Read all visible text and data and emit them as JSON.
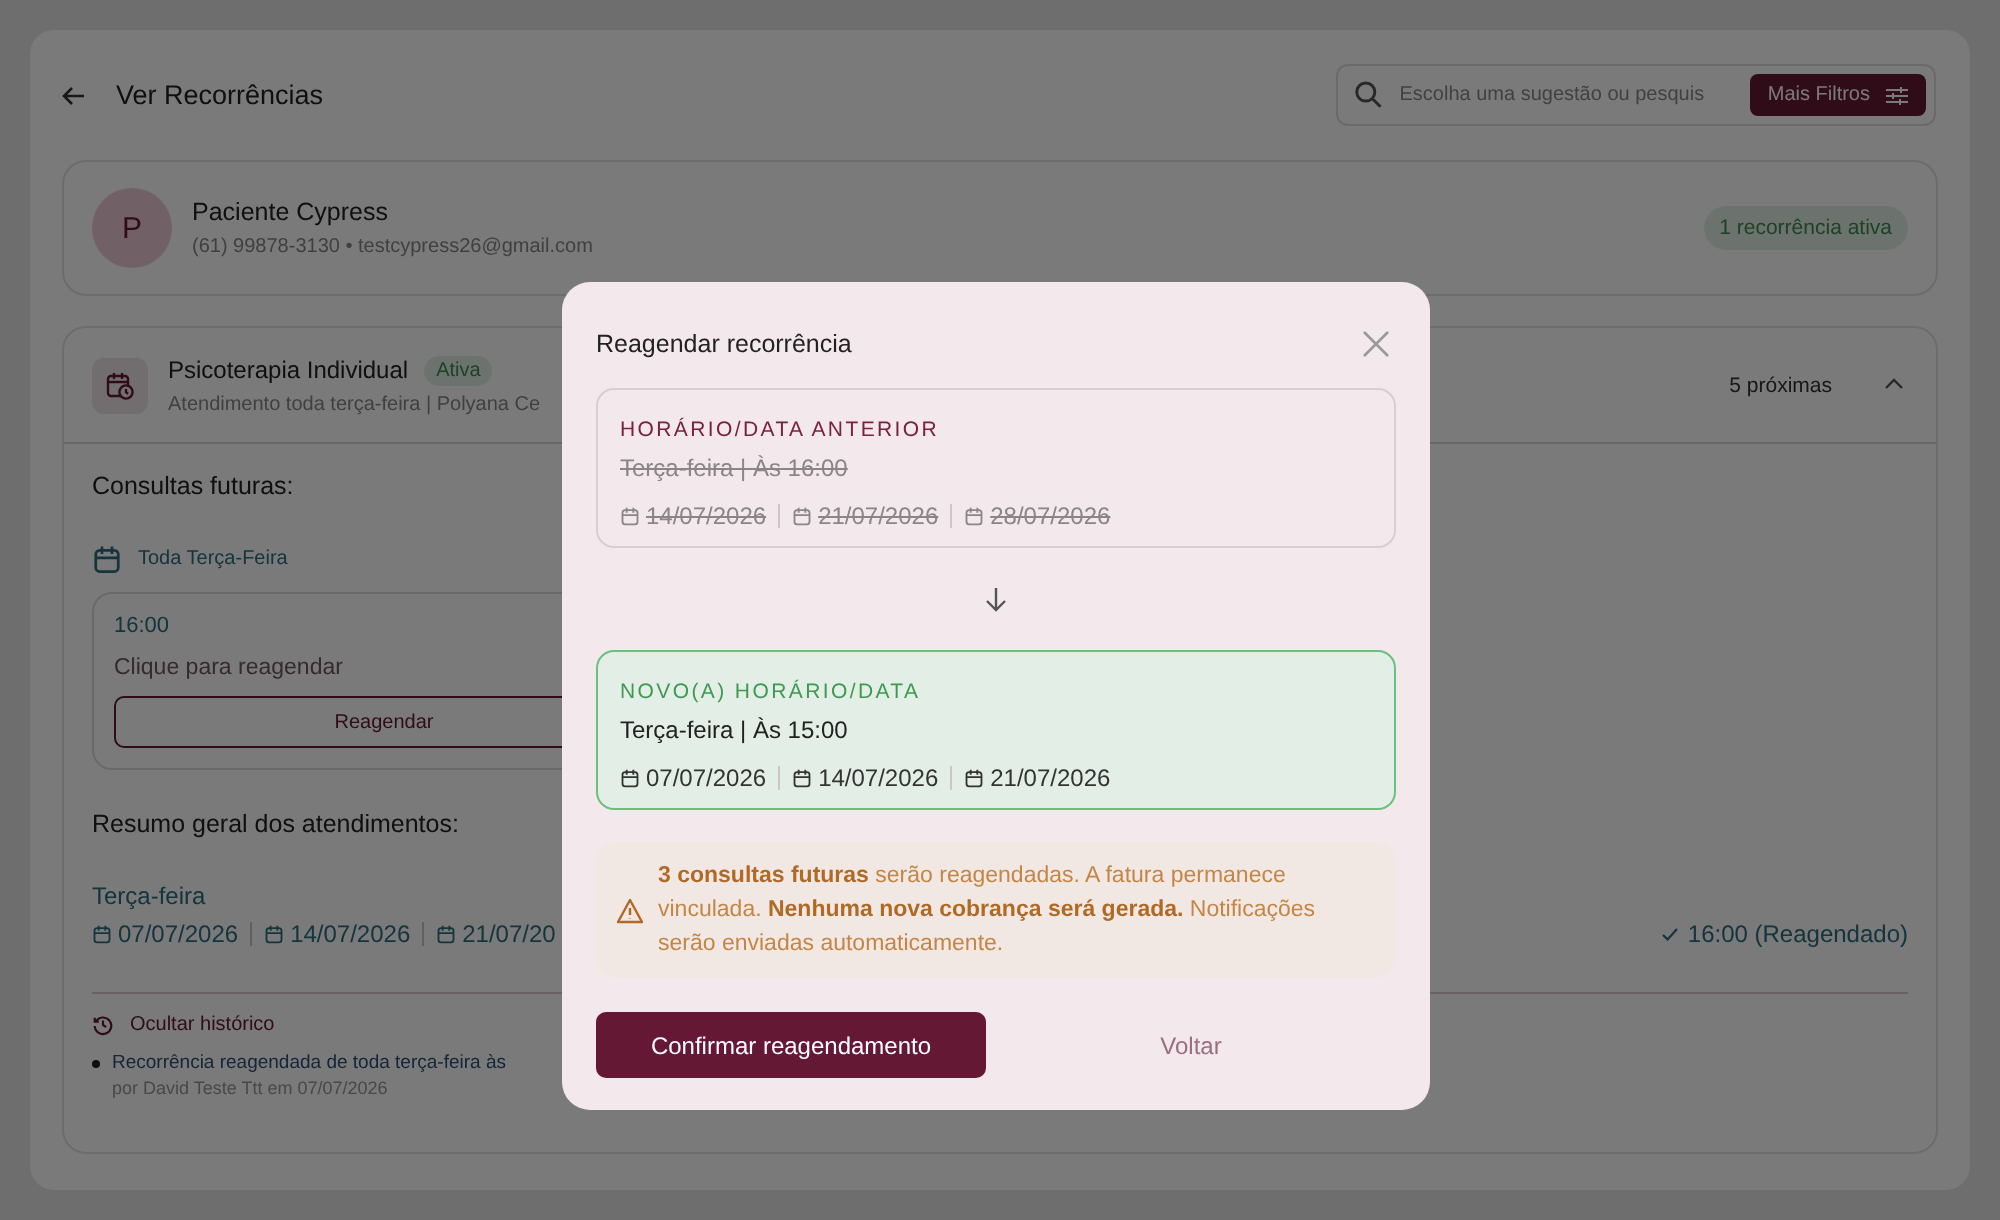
{
  "header": {
    "title": "Ver Recorrências",
    "search": {
      "placeholder": "Escolha uma sugestão ou pesquis"
    },
    "filter_button": "Mais Filtros"
  },
  "patient": {
    "initial": "P",
    "name": "Paciente Cypress",
    "contact": "(61) 99878-3130 • testcypress26@gmail.com",
    "badge": "1 recorrência ativa"
  },
  "recurrence": {
    "title": "Psicoterapia Individual",
    "status": "Ativa",
    "subtitle": "Atendimento toda terça-feira | Polyana Ce",
    "upcoming": "5 próximas",
    "expanded": true,
    "future_heading": "Consultas futuras:",
    "weekday": "Toda Terça-Feira",
    "slot": {
      "time": "16:00",
      "hint": "Clique para reagendar",
      "button": "Reagendar"
    },
    "summary_heading": "Resumo geral dos atendimentos:",
    "summary_day": "Terça-feira",
    "summary_dates": [
      "07/07/2026",
      "14/07/2026",
      "21/07/20"
    ],
    "summary_status": "16:00 (Reagendado)",
    "history_toggle": "Ocultar histórico",
    "history": [
      {
        "text": "Recorrência reagendada de toda terça-feira às",
        "meta": "por David Teste Ttt em 07/07/2026"
      }
    ]
  },
  "modal": {
    "title": "Reagendar recorrência",
    "schedules": [
      {
        "kind": "previous",
        "label": "HORÁRIO/DATA ANTERIOR",
        "schedule": "Terça-feira | Às 16:00",
        "dates": [
          "14/07/2026",
          "21/07/2026",
          "28/07/2026"
        ]
      },
      {
        "kind": "new",
        "label": "NOVO(A) HORÁRIO/DATA",
        "schedule": "Terça-feira | Às 15:00",
        "dates": [
          "07/07/2026",
          "14/07/2026",
          "21/07/2026"
        ]
      }
    ],
    "warning": "**3 consultas futuras** serão reagendadas. A fatura permanece vinculada. **Nenhuma nova cobrança será gerada.** Notificações serão enviadas automaticamente.",
    "confirm_button": "Confirmar reagendamento",
    "back_button": "Voltar"
  }
}
